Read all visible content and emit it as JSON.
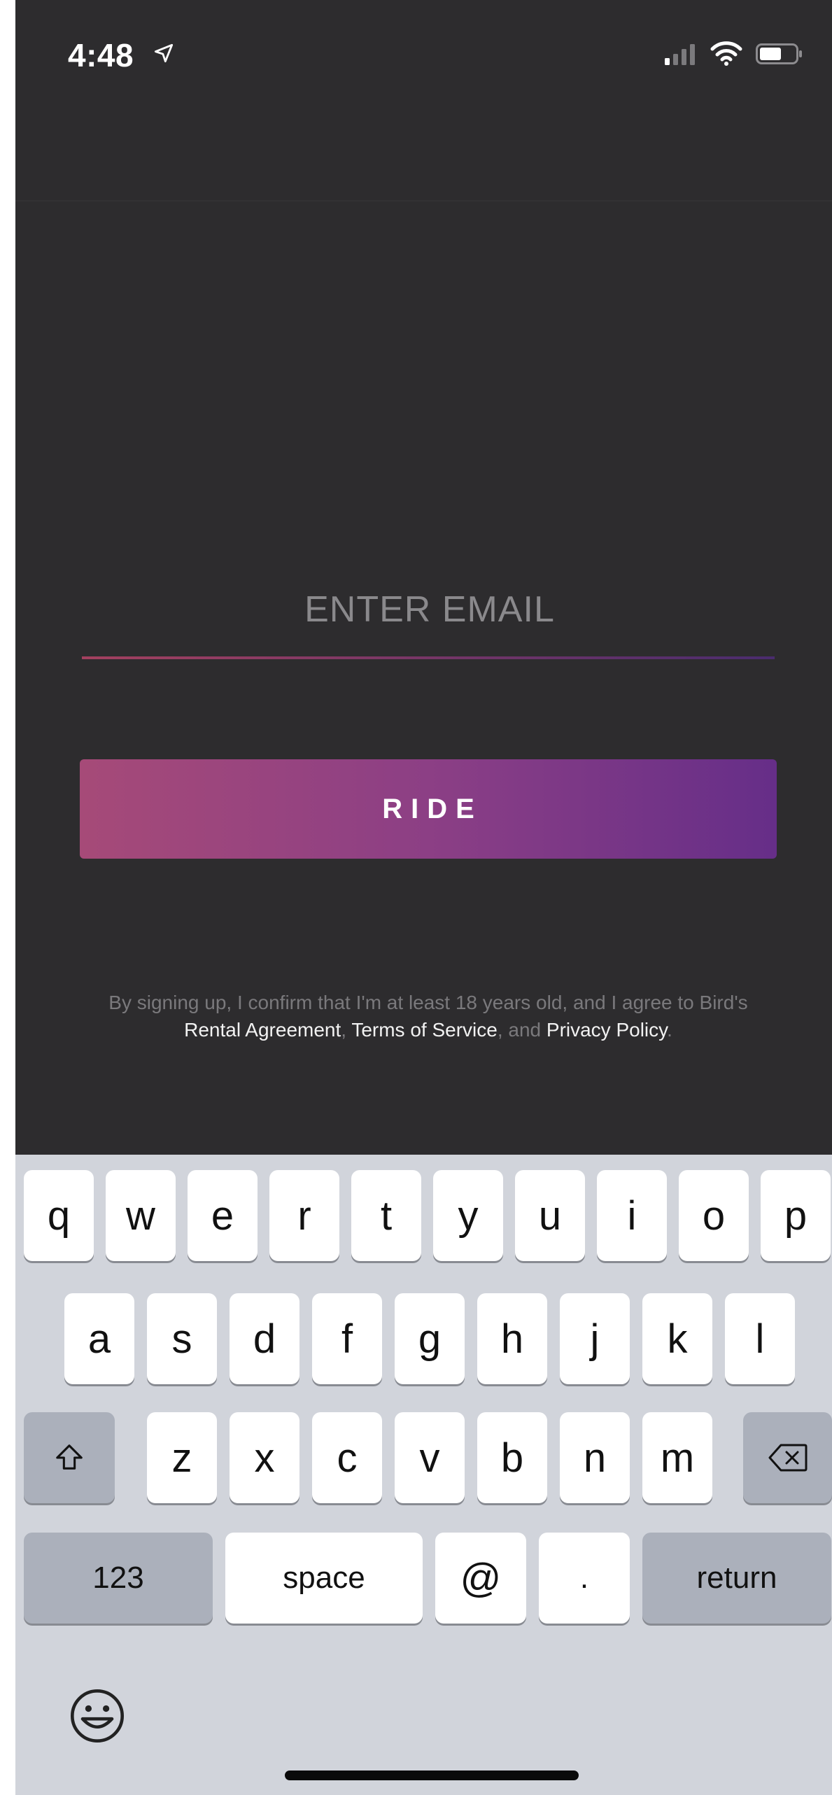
{
  "status_bar": {
    "time": "4:48"
  },
  "login": {
    "email_placeholder": "ENTER EMAIL",
    "email_value": "",
    "ride_label": "RIDE",
    "legal": {
      "prefix": "By signing up, I confirm that I'm at least 18 years old, and I agree to Bird's",
      "rental_agreement": "Rental Agreement",
      "comma": ",",
      "terms": "Terms of Service",
      "and": ", and",
      "privacy": "Privacy Policy",
      "period": "."
    }
  },
  "keyboard": {
    "row1": [
      "q",
      "w",
      "e",
      "r",
      "t",
      "y",
      "u",
      "i",
      "o",
      "p"
    ],
    "row2": [
      "a",
      "s",
      "d",
      "f",
      "g",
      "h",
      "j",
      "k",
      "l"
    ],
    "row3": [
      "z",
      "x",
      "c",
      "v",
      "b",
      "n",
      "m"
    ],
    "numbers_label": "123",
    "space_label": "space",
    "at_label": "@",
    "dot_label": ".",
    "return_label": "return"
  },
  "icons": {
    "location": "location-arrow-icon",
    "signal": "cellular-signal-icon",
    "wifi": "wifi-icon",
    "battery": "battery-icon",
    "shift": "shift-icon",
    "delete": "backspace-icon",
    "emoji": "emoji-icon"
  },
  "colors": {
    "background": "#2d2c2e",
    "ride_gradient_start": "#a64a78",
    "ride_gradient_end": "#662e88",
    "keyboard_bg": "#d1d4db"
  }
}
